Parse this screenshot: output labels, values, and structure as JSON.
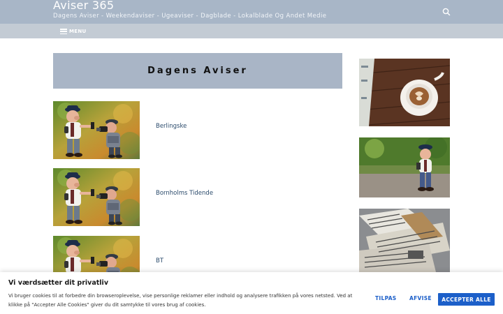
{
  "header": {
    "site_title": "Aviser 365",
    "tagline": "Dagens Aviser - Weekendaviser - Ugeaviser - Dagblade - Lokalblade Og Andet Medie",
    "search_icon": "search-icon"
  },
  "nav": {
    "menu_label": "MENU",
    "menu_icon": "hamburger-icon"
  },
  "main": {
    "heading": "Dagens Aviser",
    "items": [
      {
        "label": "Berlingske"
      },
      {
        "label": "Bornholms Tidende"
      },
      {
        "label": "BT"
      }
    ]
  },
  "sidebar": {
    "images": [
      "coffee-and-newspaper-image",
      "reporter-figurine-image",
      "newspaper-stack-image"
    ]
  },
  "cookie": {
    "title": "Vi værdsætter dit privatliv",
    "text": "Vi bruger cookies til at forbedre din browseroplevelse, vise personlige reklamer eller indhold og analysere trafikken på vores netsted. Ved at klikke på \"Accepter Alle Cookies\" giver du dit samtykke til vores brug af cookies.",
    "customize_label": "TILPAS",
    "reject_label": "AFVISE",
    "accept_label": "ACCEPTER ALLE"
  },
  "colors": {
    "header_bg": "#a8b6c7",
    "nav_bg": "#c3cbd4",
    "heading_bg": "#a9b5c6",
    "link": "#2a4a6b",
    "accent": "#1c5fc9"
  }
}
